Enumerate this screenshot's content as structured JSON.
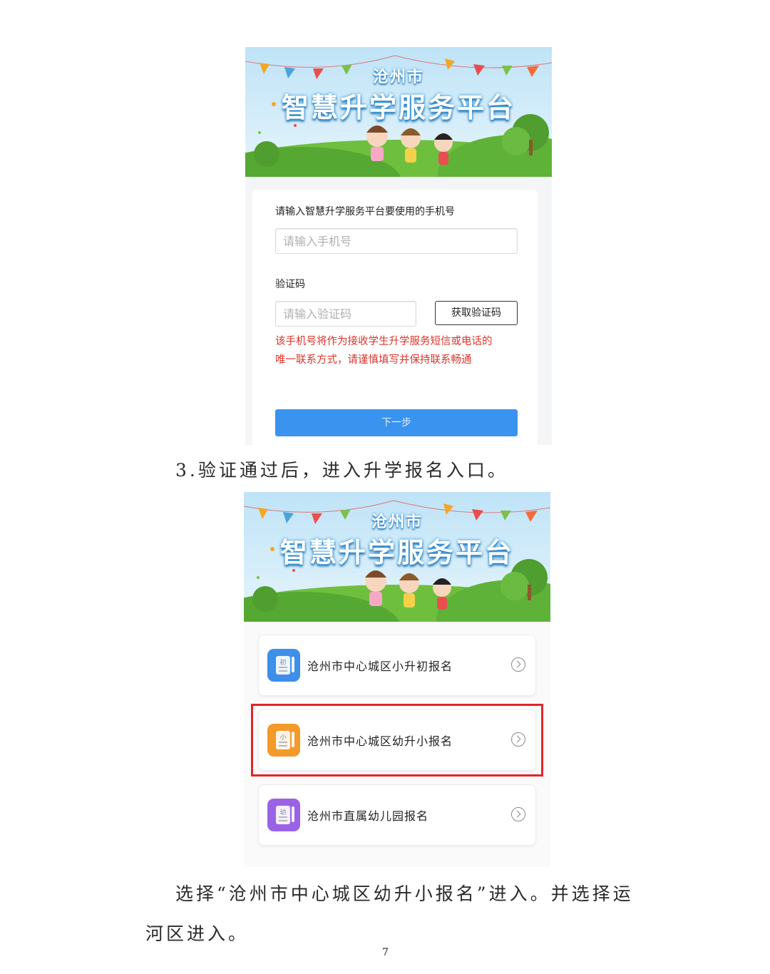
{
  "login_screen": {
    "banner": {
      "city": "沧州市",
      "title": "智慧升学服务平台"
    },
    "phone_label": "请输入智慧升学服务平台要使用的手机号",
    "phone_placeholder": "请输入手机号",
    "code_label": "验证码",
    "code_placeholder": "请输入验证码",
    "get_code_button": "获取验证码",
    "warning_line1": "该手机号将作为接收学生升学服务短信或电话的",
    "warning_line2": "唯一联系方式，请谨慎填写并保持联系畅通",
    "next_button": "下一步"
  },
  "step3_text": "3.验证通过后，进入升学报名入口。",
  "menu_screen": {
    "banner": {
      "city": "沧州市",
      "title": "智慧升学服务平台"
    },
    "items": [
      {
        "label": "沧州市中心城区小升初报名",
        "icon_glyph": "初",
        "icon_color": "#3d8fe8"
      },
      {
        "label": "沧州市中心城区幼升小报名",
        "icon_glyph": "小",
        "icon_color": "#f39a2b"
      },
      {
        "label": "沧州市直属幼儿园报名",
        "icon_glyph": "幼",
        "icon_color": "#9a63e6"
      }
    ],
    "highlight_color": "#e3242b"
  },
  "instruction_line1": "选择“沧州市中心城区幼升小报名”进入。并选择运",
  "instruction_line2": "河区进入。",
  "page_number": "7"
}
